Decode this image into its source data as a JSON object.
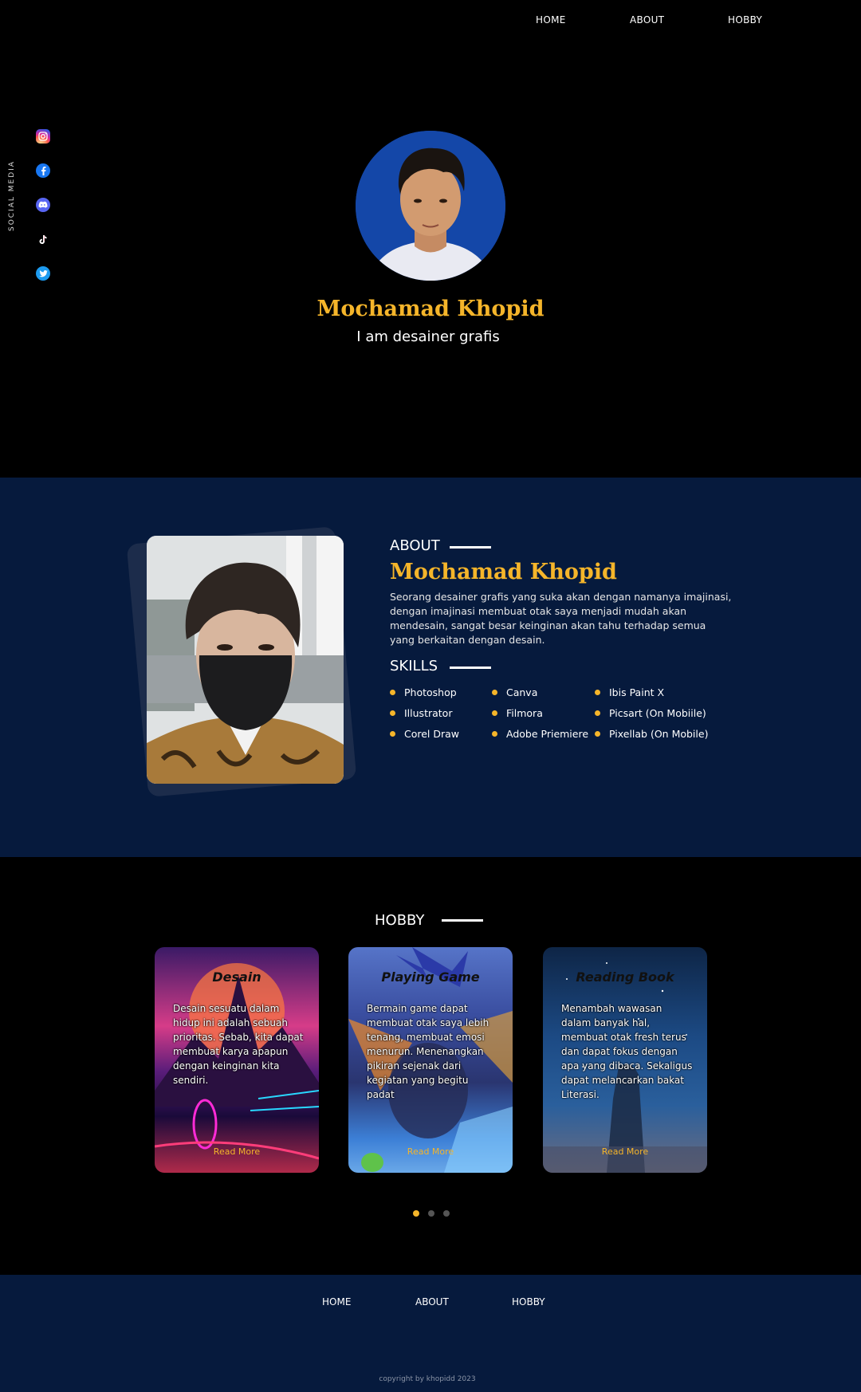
{
  "nav": {
    "home": "HOME",
    "about": "ABOUT",
    "hobby": "HOBBY"
  },
  "social": {
    "label": "SOCIAL MEDIA",
    "icons": [
      "instagram-icon",
      "facebook-icon",
      "discord-icon",
      "tiktok-icon",
      "twitter-icon"
    ]
  },
  "hero": {
    "name": "Mochamad Khopid",
    "tagline": "I am desainer grafis"
  },
  "about": {
    "title": "ABOUT",
    "name": "Mochamad Khopid",
    "description": "Seorang desainer grafis yang suka akan dengan namanya imajinasi, dengan imajinasi membuat otak saya menjadi mudah akan mendesain, sangat besar keinginan akan tahu terhadap semua yang berkaitan dengan desain.",
    "skills_title": "SKILLS",
    "skills": [
      "Photoshop",
      "Canva",
      "Ibis Paint X",
      "Illustrator",
      "Filmora",
      "Picsart  (On Mobiile)",
      "Corel Draw",
      "Adobe Priemiere",
      "Pixellab (On Mobile)"
    ]
  },
  "hobby": {
    "title": "HOBBY",
    "cards": [
      {
        "title": "Desain",
        "text": "Desain sesuatu dalam hidup ini adalah sebuah prioritas. Sebab, kita dapat membuat karya apapun dengan keinginan kita sendiri.",
        "link": "Read More"
      },
      {
        "title": "Playing Game",
        "text": "Bermain game dapat membuat otak saya lebih tenang, membuat emosi menurun. Menenangkan pikiran sejenak dari kegiatan yang begitu padat",
        "link": "Read More"
      },
      {
        "title": "Reading Book",
        "text": "Menambah wawasan dalam banyak hal, membuat otak fresh terus dan dapat fokus dengan apa yang dibaca. Sekaligus dapat melancarkan bakat Literasi.",
        "link": "Read More"
      }
    ]
  },
  "footer": {
    "home": "HOME",
    "about": "ABOUT",
    "hobby": "HOBBY",
    "copyright": "copyright by khopidd 2023"
  },
  "colors": {
    "accent": "#f5b52a",
    "navy": "#061a3d",
    "background": "#000000"
  }
}
